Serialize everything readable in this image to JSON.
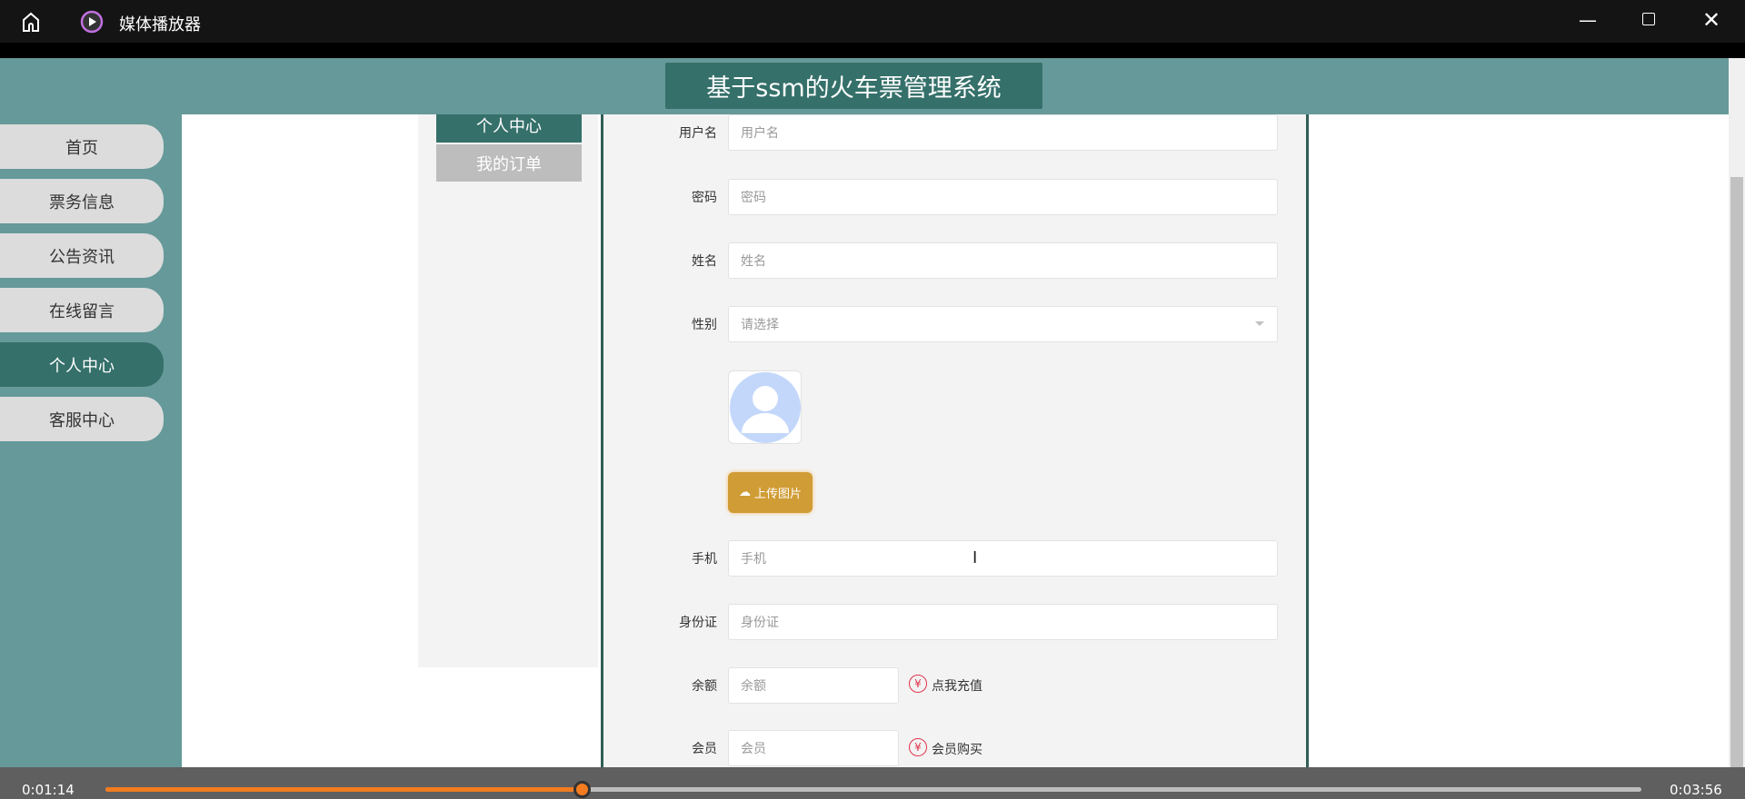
{
  "player": {
    "title": "媒体播放器",
    "current_time": "0:01:14",
    "total_time": "0:03:56",
    "progress_fraction": 0.31,
    "accent": "#f47c20"
  },
  "header": {
    "title": "基于ssm的火车票管理系统"
  },
  "sidebar": {
    "items": [
      {
        "label": "首页"
      },
      {
        "label": "票务信息"
      },
      {
        "label": "公告资讯"
      },
      {
        "label": "在线留言"
      },
      {
        "label": "个人中心",
        "active": true
      },
      {
        "label": "客服中心"
      }
    ]
  },
  "submenu": {
    "items": [
      {
        "label": "个人中心"
      },
      {
        "label": "我的订单"
      }
    ]
  },
  "form": {
    "username": {
      "label": "用户名",
      "placeholder": "用户名"
    },
    "password": {
      "label": "密码",
      "placeholder": "密码"
    },
    "name": {
      "label": "姓名",
      "placeholder": "姓名"
    },
    "gender": {
      "label": "性别",
      "placeholder": "请选择"
    },
    "upload_label": "上传图片",
    "phone": {
      "label": "手机",
      "placeholder": "手机"
    },
    "id_card": {
      "label": "身份证",
      "placeholder": "身份证"
    },
    "balance": {
      "label": "余额",
      "placeholder": "余额",
      "action": "点我充值"
    },
    "member": {
      "label": "会员",
      "placeholder": "会员",
      "action": "会员购买"
    },
    "yen_symbol": "¥"
  }
}
